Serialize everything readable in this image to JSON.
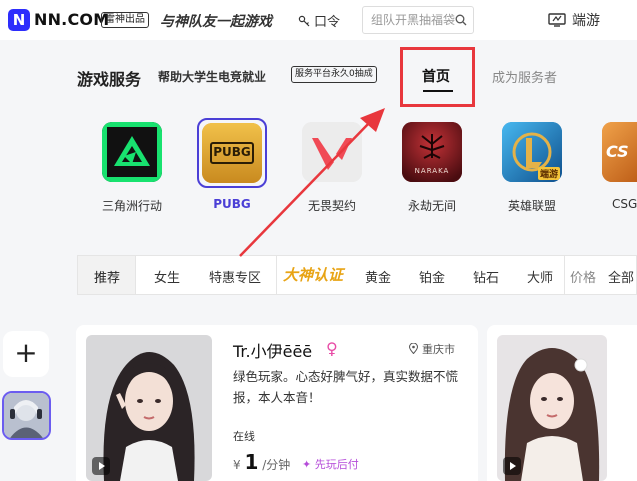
{
  "header": {
    "logo_mark": "N",
    "logo_text": "NN.COM",
    "brand_tag": "雷神出品",
    "slogan": "与神队友一起游戏",
    "kouling": "口令",
    "search_placeholder": "组队开黑抽福袋",
    "duanyou": "端游"
  },
  "section": {
    "title": "游戏服务",
    "subtitle": "帮助大学生电竞就业",
    "badge": "服务平台永久0抽成",
    "tabs": [
      "首页",
      "成为服务者"
    ]
  },
  "games": [
    {
      "name": "三角洲行动",
      "icon": "delta-force-icon",
      "color": "#15e06f"
    },
    {
      "name": "PUBG",
      "icon": "pubg-icon",
      "color": "#e0a82e",
      "active": true
    },
    {
      "name": "无畏契约",
      "icon": "valorant-icon",
      "color": "#ef4a55"
    },
    {
      "name": "永劫无间",
      "icon": "naraka-icon",
      "color": "#8b1e24"
    },
    {
      "name": "英雄联盟",
      "icon": "lol-icon",
      "color": "#1b8fd0"
    },
    {
      "name": "CSG",
      "icon": "csgo-icon",
      "color": "#e07b20"
    }
  ],
  "game_texts": {
    "pubg_logo": "PUBG",
    "naraka_logo": "NARAKA",
    "lol_badge": "端游",
    "cs_logo": "CS"
  },
  "filters": {
    "items": [
      "推荐",
      "女生",
      "特惠专区"
    ],
    "god_label": "大神认证",
    "ranks": [
      "黄金",
      "铂金",
      "钻石",
      "大师"
    ],
    "price_label": "价格",
    "all_label": "全部"
  },
  "sidebar": {
    "add_label": "+"
  },
  "card": {
    "name": "Tr.小伊ēēē",
    "gender_symbol": "♀",
    "location": "重庆市",
    "description": "绿色玩家。心态好脾气好，真实数据不慌报，本人本音！",
    "status": "在线",
    "currency": "¥",
    "price": "1",
    "unit": "/分钟",
    "tag": "先玩后付"
  }
}
